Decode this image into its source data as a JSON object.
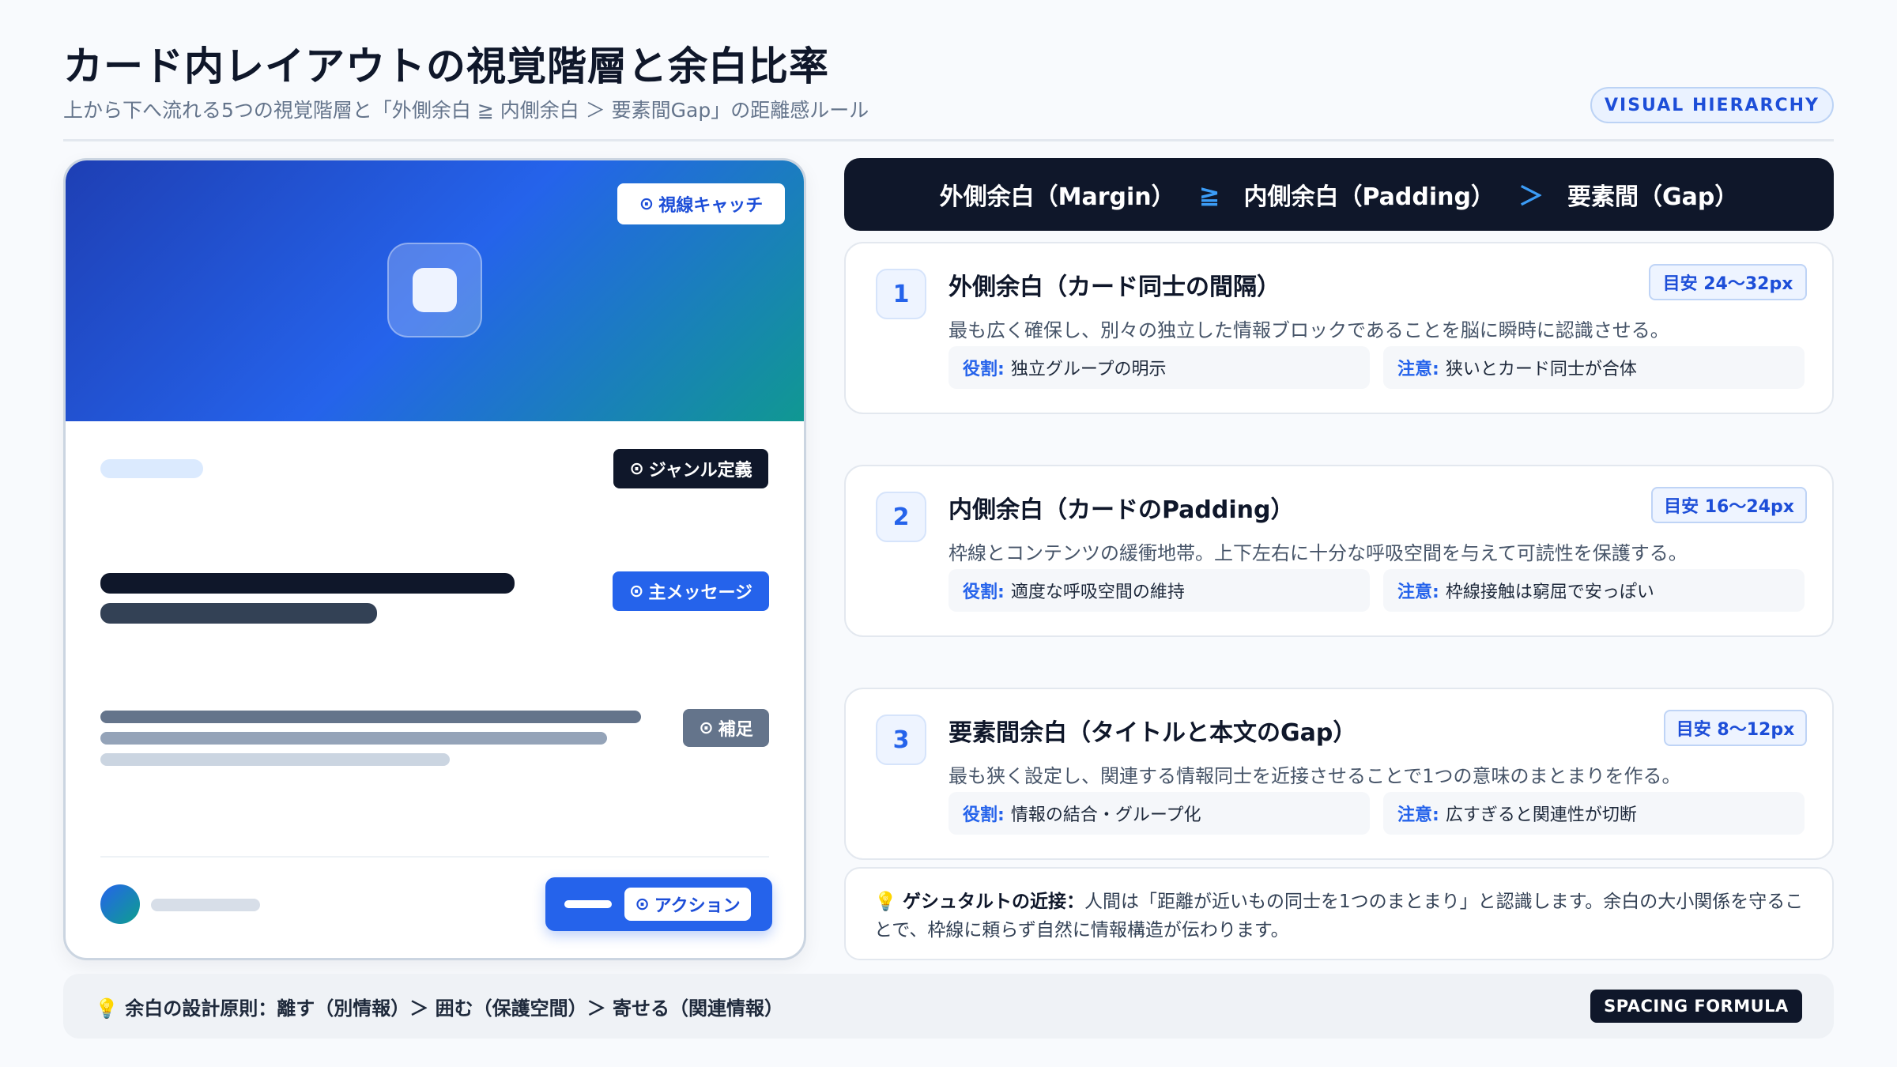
{
  "header": {
    "title": "カード内レイアウトの視覚階層と余白比率",
    "subtitle": "上から下へ流れる5つの視覚階層と「外側余白 ≧ 内側余白 ＞ 要素間Gap」の距離感ルール",
    "badge": "VISUAL HIERARCHY"
  },
  "card_mock": {
    "tags": {
      "eye_catch": "視線キャッチ",
      "genre": "ジャンル定義",
      "main_message": "主メッセージ",
      "supplement": "補足",
      "action": "アクション"
    },
    "tag_icon": "target-icon"
  },
  "formula": {
    "outer": "外側余白（Margin）",
    "op1": "≧",
    "inner": "内側余白（Padding）",
    "op2": "＞",
    "gap": "要素間（Gap）"
  },
  "rules": [
    {
      "num": "1",
      "title": "外側余白（カード同士の間隔）",
      "badge": "目安 24〜32px",
      "desc": "最も広く確保し、別々の独立した情報ブロックであることを脳に瞬時に認識させる。",
      "role_key": "役割:",
      "role": "独立グループの明示",
      "note_key": "注意:",
      "note": "狭いとカード同士が合体"
    },
    {
      "num": "2",
      "title": "内側余白（カードのPadding）",
      "badge": "目安 16〜24px",
      "desc": "枠線とコンテンツの緩衝地帯。上下左右に十分な呼吸空間を与えて可読性を保護する。",
      "role_key": "役割:",
      "role": "適度な呼吸空間の維持",
      "note_key": "注意:",
      "note": "枠線接触は窮屈で安っぽい"
    },
    {
      "num": "3",
      "title": "要素間余白（タイトルと本文のGap）",
      "badge": "目安 8〜12px",
      "desc": "最も狭く設定し、関連する情報同士を近接させることで1つの意味のまとまりを作る。",
      "role_key": "役割:",
      "role": "情報の結合・グループ化",
      "note_key": "注意:",
      "note": "広すぎると関連性が切断"
    }
  ],
  "gestalt": {
    "icon": "lightbulb-icon",
    "label": "ゲシュタルトの近接：",
    "text": "人間は「距離が近いもの同士を1つのまとまり」と認識します。余白の大小関係を守ることで、枠線に頼らず自然に情報構造が伝わります。"
  },
  "footer": {
    "icon": "lightbulb-icon",
    "text": "余白の設計原則：離す（別情報）＞ 囲む（保護空間）＞ 寄せる（関連情報）",
    "badge": "SPACING FORMULA"
  },
  "colors": {
    "accent": "#2563eb",
    "dark": "#0f172a",
    "hero_gradient_start": "#1e3fb4",
    "hero_gradient_end": "#109892"
  }
}
